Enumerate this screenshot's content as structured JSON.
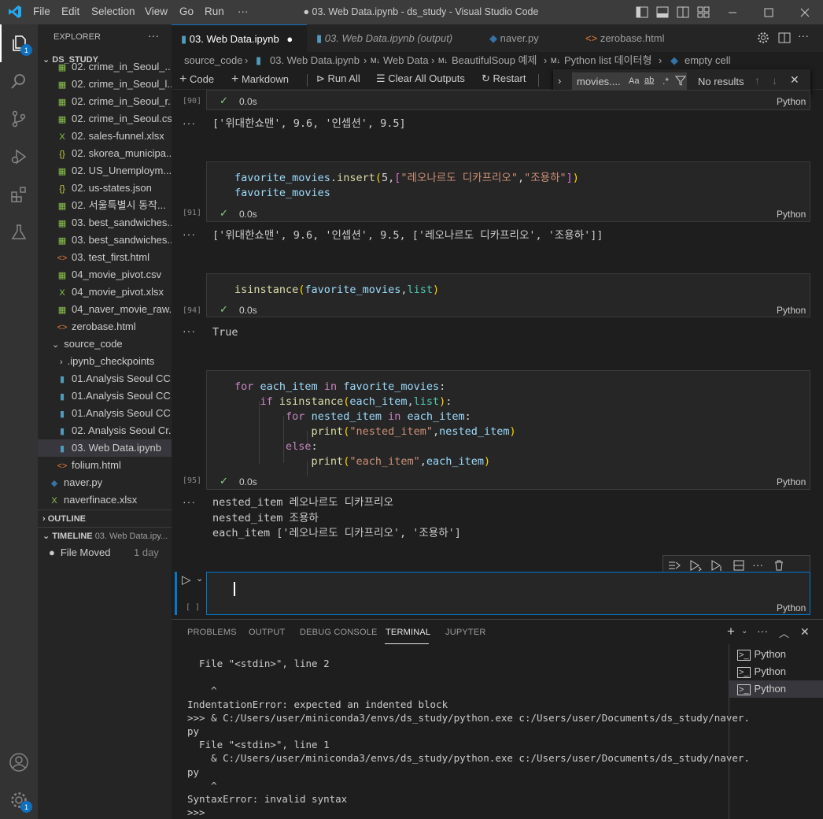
{
  "titlebar": {
    "menus": [
      "File",
      "Edit",
      "Selection",
      "View",
      "Go",
      "Run",
      "···"
    ],
    "title": "● 03. Web Data.ipynb - ds_study - Visual Studio Code"
  },
  "activity": {
    "explorer_badge": "1",
    "settings_badge": "1"
  },
  "sidebar": {
    "header": "EXPLORER",
    "more": "···",
    "root": "DS_STUDY",
    "files": [
      {
        "icon": "csv",
        "label": "02. crime_in_Seoul_..."
      },
      {
        "icon": "csv",
        "label": "02. crime_in_Seoul_l..."
      },
      {
        "icon": "csv",
        "label": "02. crime_in_Seoul_r..."
      },
      {
        "icon": "csv",
        "label": "02. crime_in_Seoul.csv"
      },
      {
        "icon": "xlsx",
        "label": "02. sales-funnel.xlsx"
      },
      {
        "icon": "json",
        "label": "02. skorea_municipa..."
      },
      {
        "icon": "csv",
        "label": "02. US_Unemploym..."
      },
      {
        "icon": "json",
        "label": "02. us-states.json"
      },
      {
        "icon": "csv",
        "label": "02. 서울특별시 동작..."
      },
      {
        "icon": "csv",
        "label": "03. best_sandwiches..."
      },
      {
        "icon": "csv",
        "label": "03. best_sandwiches..."
      },
      {
        "icon": "html",
        "label": "03. test_first.html"
      },
      {
        "icon": "csv",
        "label": "04_movie_pivot.csv"
      },
      {
        "icon": "xlsx",
        "label": "04_movie_pivot.xlsx"
      },
      {
        "icon": "csv",
        "label": "04_naver_movie_raw..."
      },
      {
        "icon": "html",
        "label": "zerobase.html"
      }
    ],
    "folder": "source_code",
    "subfolder": ".ipynb_checkpoints",
    "subfiles": [
      {
        "icon": "ipynb",
        "label": "01.Analysis Seoul CC..."
      },
      {
        "icon": "ipynb",
        "label": "01.Analysis Seoul CC..."
      },
      {
        "icon": "ipynb",
        "label": "01.Analysis Seoul CC..."
      },
      {
        "icon": "ipynb",
        "label": "02. Analysis Seoul Cr..."
      },
      {
        "icon": "ipynb",
        "label": "03. Web Data.ipynb"
      },
      {
        "icon": "html",
        "label": "folium.html"
      }
    ],
    "rootfiles": [
      {
        "icon": "py",
        "label": "naver.py"
      },
      {
        "icon": "xlsx",
        "label": "naverfinace.xlsx"
      }
    ],
    "outline": "OUTLINE",
    "timeline": "TIMELINE",
    "timeline_file": "03. Web Data.ipy...",
    "timeline_event": "File Moved",
    "timeline_when": "1 day"
  },
  "tabs": [
    {
      "label": "03. Web Data.ipynb",
      "active": true,
      "dirty": "●"
    },
    {
      "label": "03. Web Data.ipynb (output)",
      "active": false
    },
    {
      "label": "naver.py",
      "active": false
    },
    {
      "label": "zerobase.html",
      "active": false
    }
  ],
  "breadcrumb": {
    "parts": [
      "source_code",
      "03. Web Data.ipynb",
      "Web Data",
      "BeautifulSoup 예제",
      "Python list 데이터형",
      "empty cell"
    ]
  },
  "toolbar": {
    "code": "Code",
    "markdown": "Markdown",
    "run_all": "Run All",
    "clear": "Clear All Outputs",
    "restart": "Restart"
  },
  "find": {
    "query": "movies....",
    "result": "No results",
    "case": "Aa",
    "word": "ab",
    "regex": ".*"
  },
  "cells": {
    "c90": {
      "exec": "[90]",
      "time": "0.0s",
      "lang": "Python",
      "output": "['위대한쇼맨', 9.6, '인셉션', 9.5]"
    },
    "c91": {
      "exec": "[91]",
      "time": "0.0s",
      "lang": "Python",
      "output": "['위대한쇼맨', 9.6, '인셉션', 9.5, ['레오나르도 디카프리오', '조용하']]"
    },
    "c94": {
      "exec": "[94]",
      "time": "0.0s",
      "lang": "Python",
      "output": "True"
    },
    "c95": {
      "exec": "[95]",
      "time": "0.0s",
      "lang": "Python",
      "output": [
        "nested_item 레오나르도 디카프리오",
        "nested_item 조용하",
        "each_item ['레오나르도 디카프리오', '조용하']"
      ]
    },
    "empty": {
      "exec": "[ ]",
      "lang": "Python"
    },
    "more": "···"
  },
  "panel": {
    "tabs": [
      "PROBLEMS",
      "OUTPUT",
      "DEBUG CONSOLE",
      "TERMINAL",
      "JUPYTER"
    ],
    "active_tab": "TERMINAL",
    "terminal_lines": [
      "  File \"<stdin>\", line 2",
      "",
      "    ^",
      "IndentationError: expected an indented block",
      ">>> & C:/Users/user/miniconda3/envs/ds_study/python.exe c:/Users/user/Documents/ds_study/naver.",
      "py",
      "  File \"<stdin>\", line 1",
      "    & C:/Users/user/miniconda3/envs/ds_study/python.exe c:/Users/user/Documents/ds_study/naver.",
      "py",
      "    ^",
      "SyntaxError: invalid syntax",
      ">>> "
    ],
    "terminals": [
      "Python",
      "Python",
      "Python"
    ]
  },
  "colors": {
    "accent": "#0e70c0",
    "check": "#89d185",
    "focus": "#007acc"
  }
}
